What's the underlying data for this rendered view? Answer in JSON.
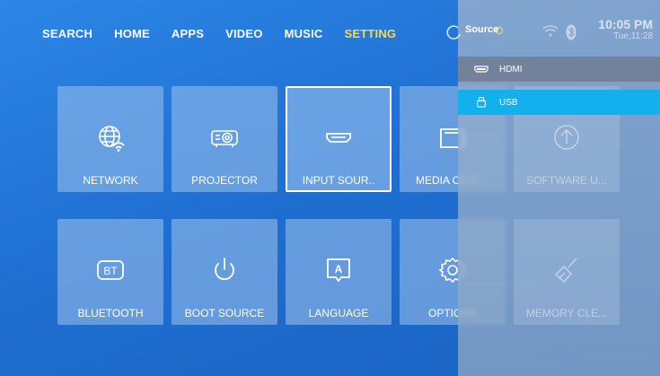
{
  "nav": [
    {
      "label": "SEARCH",
      "active": false
    },
    {
      "label": "HOME",
      "active": false
    },
    {
      "label": "APPS",
      "active": false
    },
    {
      "label": "VIDEO",
      "active": false
    },
    {
      "label": "MUSIC",
      "active": false
    },
    {
      "label": "SETTING",
      "active": true
    }
  ],
  "tiles": [
    {
      "label": "NETWORK",
      "icon": "globe-wifi-icon"
    },
    {
      "label": "PROJECTOR",
      "icon": "projector-icon"
    },
    {
      "label": "INPUT SOUR..",
      "icon": "hdmi-icon",
      "selected": true
    },
    {
      "label": "MEDIA CENT...",
      "icon": "media-icon"
    },
    {
      "label": "BLUETOOTH",
      "icon": "bt-icon"
    },
    {
      "label": "BOOT SOURCE",
      "icon": "power-icon"
    },
    {
      "label": "LANGUAGE",
      "icon": "language-icon"
    },
    {
      "label": "OPTIONS",
      "icon": "gear-icon"
    }
  ],
  "ghost_tiles": [
    {
      "label": "SOFTWARE U...",
      "icon": "upload-icon"
    },
    {
      "label": "MEMORY CLE...",
      "icon": "broom-icon"
    }
  ],
  "source_panel": {
    "title": "Source",
    "items": [
      {
        "label": "HDMI",
        "icon": "hdmi-port-icon"
      },
      {
        "label": "USB",
        "icon": "usb-icon",
        "highlighted": true
      }
    ]
  },
  "status": {
    "time": "10:05 PM",
    "date": "Tue,11:28"
  },
  "colors": {
    "accent": "#ffd84a",
    "highlight": "#12b0ec",
    "background": "#1f70d2"
  }
}
